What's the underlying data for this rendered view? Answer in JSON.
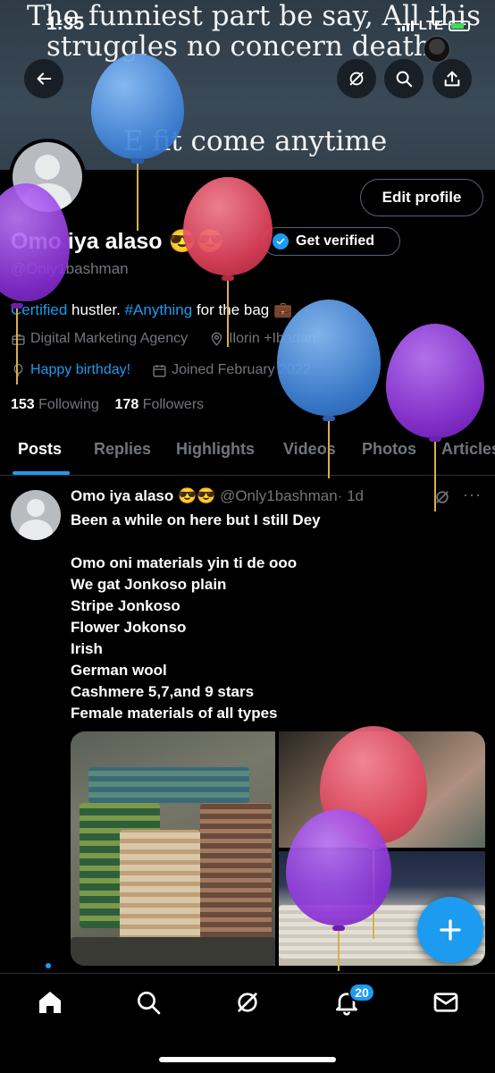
{
  "status_bar": {
    "time": "1:35",
    "network": "LTE"
  },
  "banner": {
    "line1": "The funniest part be say,  All this",
    "line2": "struggles no concern death",
    "line3": "E fit come anytime"
  },
  "header_buttons": {
    "back": "back-icon",
    "grok": "grok-icon",
    "search": "search-icon",
    "share": "share-icon"
  },
  "profile": {
    "edit_label": "Edit profile",
    "display_name": "Omo iya alaso",
    "emoji": "😎😎",
    "get_verified": "Get verified",
    "handle": "@Only1bashman",
    "bio": {
      "certified": "Certified",
      "mid": "hustler.",
      "hashtag": "#Anything",
      "rest": "for the bag 💼"
    },
    "category": "Digital Marketing Agency",
    "location": "Ilorin +Ibadan",
    "birthday": "Happy birthday!",
    "joined": "Joined February 2022",
    "following_count": "153",
    "following_label": "Following",
    "followers_count": "178",
    "followers_label": "Followers"
  },
  "tabs": [
    "Posts",
    "Replies",
    "Highlights",
    "Videos",
    "Photos",
    "Articles"
  ],
  "post": {
    "author": "Omo iya alaso 😎😎",
    "handle": "@Only1bashman",
    "time": "· 1d",
    "lines": [
      "Been a while on here but I still Dey",
      "",
      "Omo oni materials yin ti de ooo",
      "We gat Jonkoso plain",
      "Stripe Jonkoso",
      "Flower Jokonso",
      "Irish",
      "German wool",
      "Cashmere 5,7,and 9 stars",
      "Female  materials of all types"
    ],
    "more": "···"
  },
  "bottom_nav": {
    "items": [
      "home-icon",
      "search-icon",
      "grok-icon",
      "notifications-icon",
      "messages-icon"
    ],
    "notification_count": "20"
  },
  "colors": {
    "accent": "#1d9bf0",
    "background": "#000000",
    "muted_text": "#71767b",
    "balloon_blue": "#4a90e2",
    "balloon_red": "#e0485e",
    "balloon_purple": "#9b3fe0"
  }
}
